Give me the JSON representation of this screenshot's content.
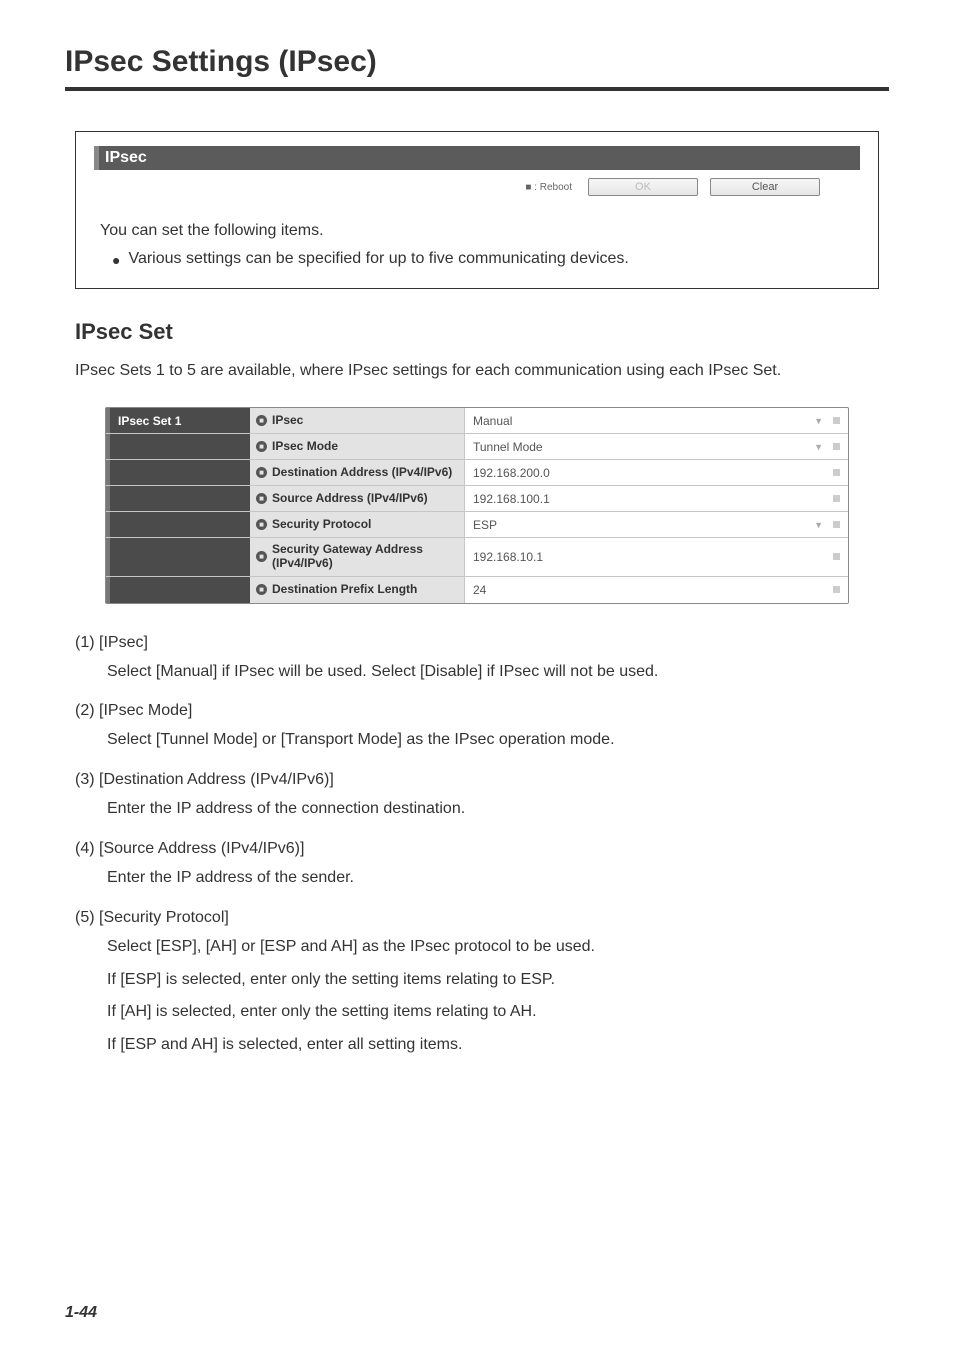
{
  "page": {
    "title": "IPsec Settings (IPsec)",
    "number": "1-44"
  },
  "intro_panel": {
    "header": "IPsec",
    "reboot_legend": "■ : Reboot",
    "ok_label": "OK",
    "clear_label": "Clear",
    "text1": "You can set the following items.",
    "bullet": "Various settings can be specified for up to five communicating devices."
  },
  "section": {
    "title": "IPsec Set",
    "desc": "IPsec Sets 1 to 5 are available, where IPsec settings for each communication using each IPsec Set."
  },
  "table": {
    "set_label": "IPsec Set 1",
    "rows": [
      {
        "label": "IPsec",
        "value": "Manual",
        "dropdown": true
      },
      {
        "label": "IPsec Mode",
        "value": "Tunnel Mode",
        "dropdown": true
      },
      {
        "label": "Destination Address (IPv4/IPv6)",
        "value": "192.168.200.0",
        "dropdown": false
      },
      {
        "label": "Source Address (IPv4/IPv6)",
        "value": "192.168.100.1",
        "dropdown": false
      },
      {
        "label": "Security Protocol",
        "value": "ESP",
        "dropdown": true
      },
      {
        "label": "Security Gateway Address (IPv4/IPv6)",
        "value": "192.168.10.1",
        "dropdown": false
      },
      {
        "label": "Destination Prefix Length",
        "value": "24",
        "dropdown": false
      }
    ]
  },
  "items": {
    "i1": {
      "label": "(1) [IPsec]",
      "body1": "Select [Manual] if IPsec will be used. Select [Disable] if IPsec will not be used."
    },
    "i2": {
      "label": "(2) [IPsec Mode]",
      "body1": "Select [Tunnel Mode] or [Transport Mode] as the IPsec operation mode."
    },
    "i3": {
      "label": "(3) [Destination Address (IPv4/IPv6)]",
      "body1": "Enter the IP address of the connection destination."
    },
    "i4": {
      "label": "(4) [Source Address (IPv4/IPv6)]",
      "body1": "Enter the IP address of the sender."
    },
    "i5": {
      "label": "(5) [Security Protocol]",
      "body1": "Select [ESP], [AH] or [ESP and AH] as the IPsec protocol to be used.",
      "body2": "If [ESP] is selected, enter only the setting items relating to ESP.",
      "body3": "If [AH] is selected, enter only the setting items relating to AH.",
      "body4": "If [ESP and AH] is selected, enter all setting items."
    }
  }
}
